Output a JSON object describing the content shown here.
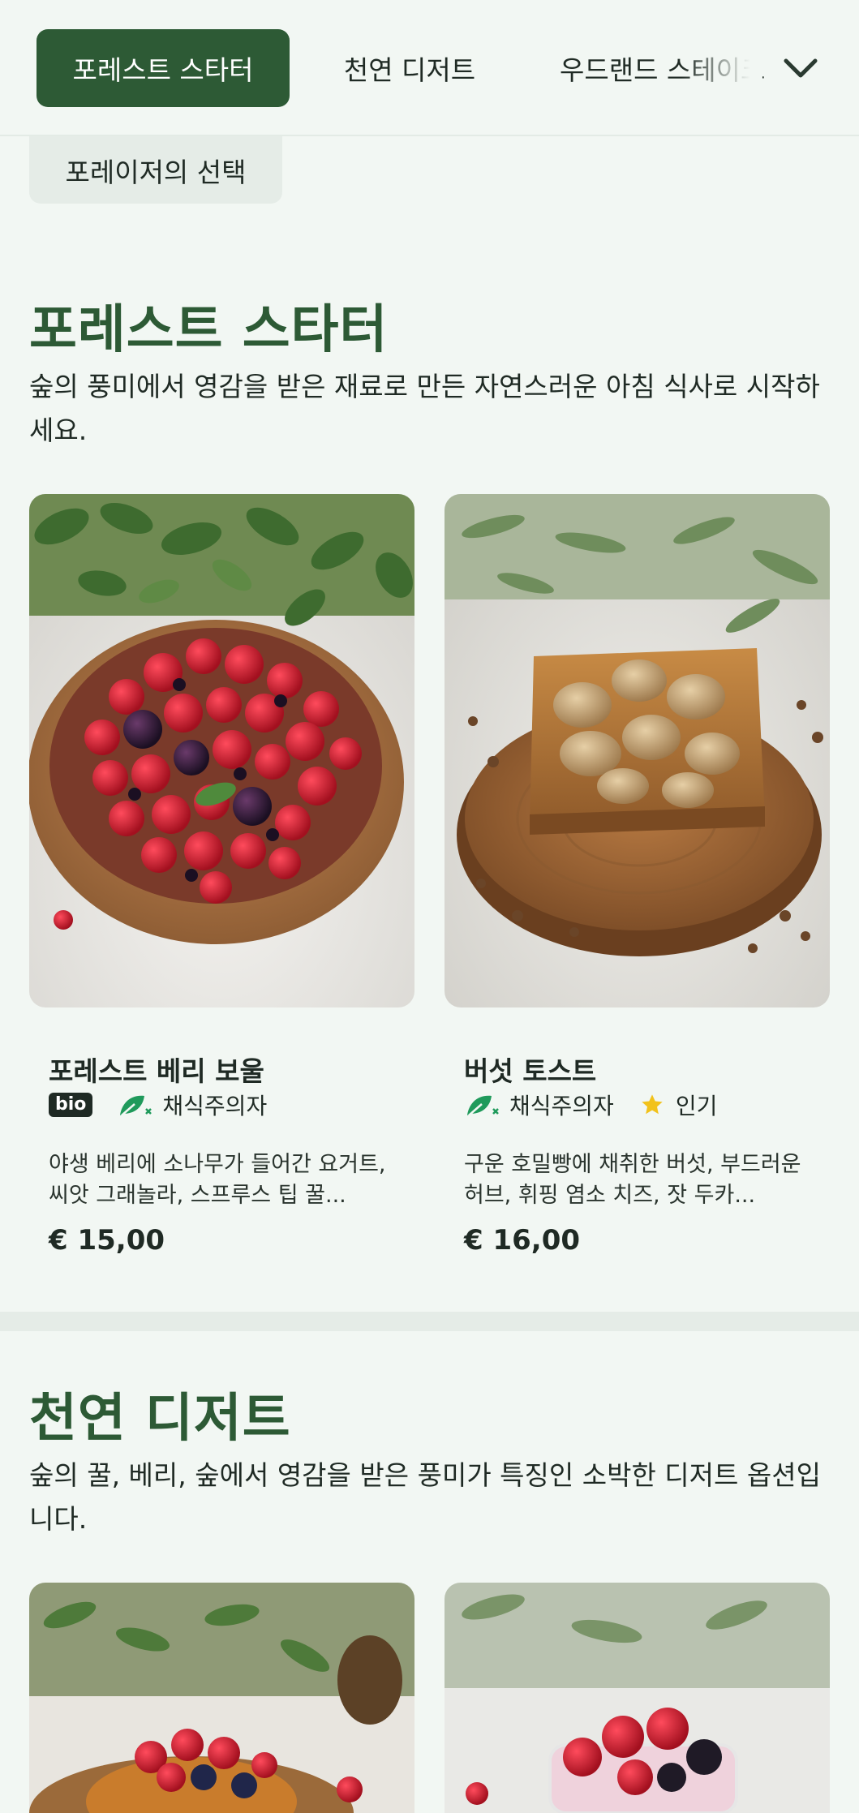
{
  "tabs": [
    {
      "label": "포레스트 스타터",
      "active": true
    },
    {
      "label": "천연 디저트",
      "active": false
    },
    {
      "label": "우드랜드 스테이크",
      "active": false
    },
    {
      "label": "포레이저의 선택",
      "active": false
    }
  ],
  "sections": [
    {
      "title": "포레스트 스타터",
      "description": "숲의 풍미에서 영감을 받은 재료로 만든 자연스러운 아침 식사로 시작하세요.",
      "items": [
        {
          "name": "포레스트 베리 보울",
          "bio": "bio",
          "tags": [
            "채식주의자"
          ],
          "description": "야생 베리에 소나무가 들어간 요거트, 씨앗 그래놀라, 스프루스 팁 꿀...",
          "price": "€ 15,00"
        },
        {
          "name": "버섯 토스트",
          "tags": [
            "채식주의자",
            "인기"
          ],
          "description": "구운 호밀빵에 채취한 버섯, 부드러운 허브, 휘핑 염소 치즈, 잣 두카...",
          "price": "€ 16,00"
        }
      ]
    },
    {
      "title": "천연 디저트",
      "description": "숲의 꿀, 베리, 숲에서 영감을 받은 풍미가 특징인 소박한 디저트 옵션입니다."
    }
  ],
  "icons": {
    "chevron": "chevron-down-icon",
    "vegetarian": "leaf-icon",
    "popular": "star-icon"
  },
  "colors": {
    "accent": "#2d5a35",
    "background": "#f2f7f3",
    "vegetarian_icon": "#1f9a5b",
    "star": "#f2c21b"
  }
}
